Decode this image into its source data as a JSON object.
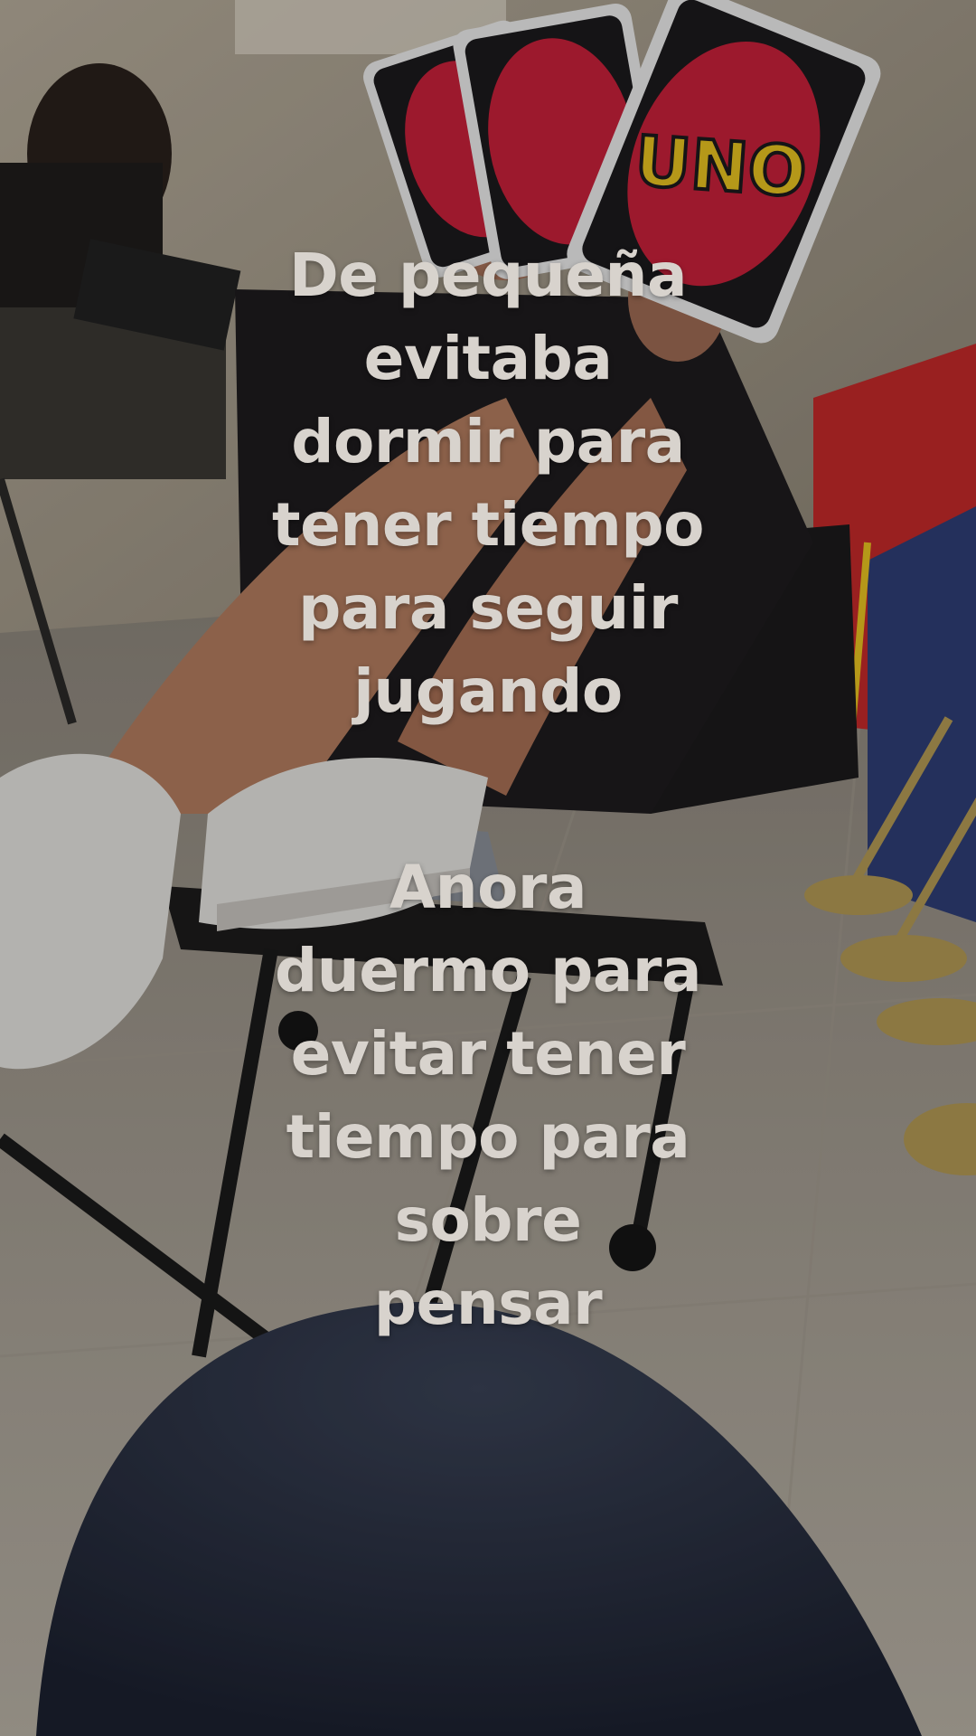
{
  "overlay_text": {
    "block_1": [
      "De pequeña",
      "evitaba",
      "dormir para",
      "tener tiempo",
      "para seguir",
      "jugando"
    ],
    "block_2": [
      "Anora",
      "duermo para",
      "evitar tener",
      "tiempo para",
      "sobre",
      "pensar"
    ]
  },
  "photo": {
    "card_logo_text": "UNO",
    "subject": "person-holding-uno-cards-on-chair",
    "colors": {
      "card_red": "#c8203a",
      "card_black": "#1b1a1d",
      "card_yellow": "#e8c321",
      "wall_red": "#c42a2a",
      "wall_blue": "#2f3e76",
      "sneaker_white": "#e6e4e0",
      "floor_tile": "#cfc8bd",
      "denim": "#2c3446"
    }
  }
}
